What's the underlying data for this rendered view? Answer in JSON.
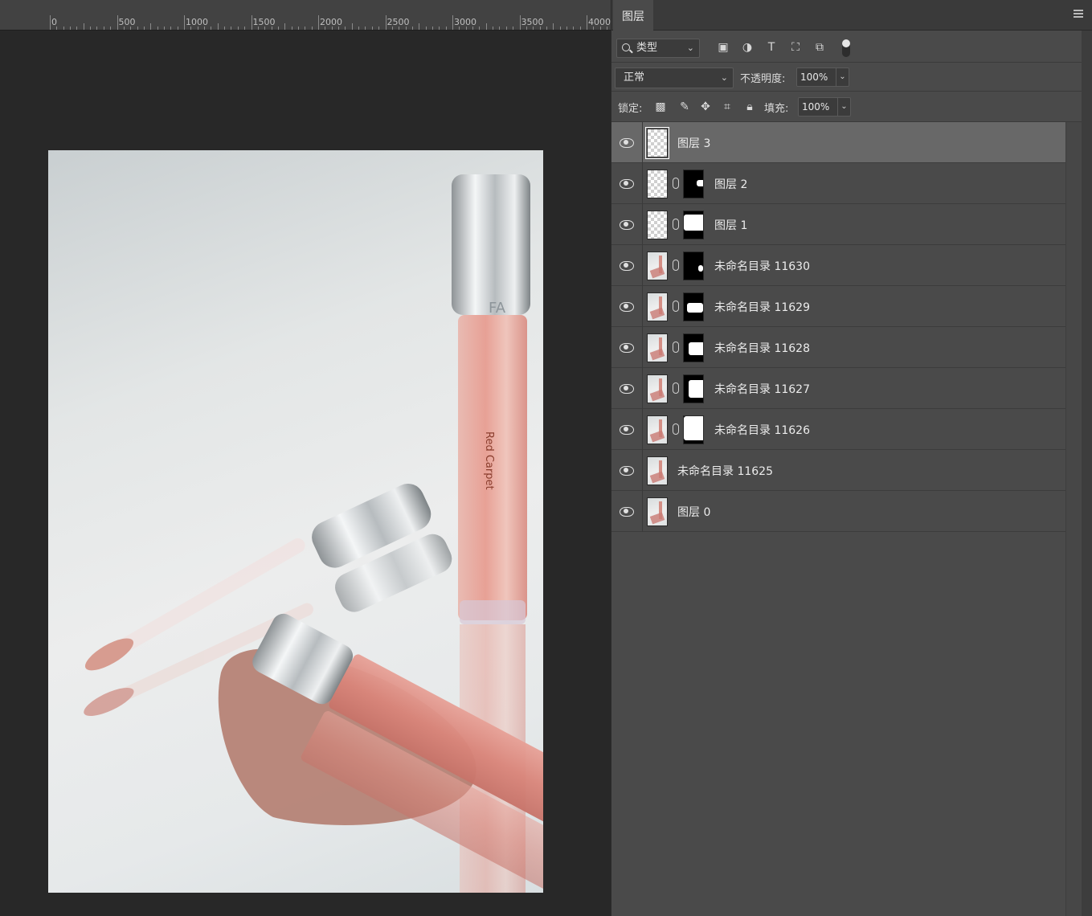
{
  "ruler": {
    "labels": [
      "0",
      "500",
      "1000",
      "1500",
      "2000",
      "2500",
      "3000",
      "3500",
      "4000"
    ]
  },
  "panel": {
    "tab_label": "图层",
    "filter": {
      "label": "类型"
    },
    "filter_icons": [
      "image-filter-icon",
      "adjustment-filter-icon",
      "type-filter-icon",
      "shape-filter-icon",
      "smart-object-filter-icon"
    ],
    "blend_mode": "正常",
    "opacity_label": "不透明度:",
    "opacity_value": "100%",
    "lock_label": "锁定:",
    "fill_label": "填充:",
    "fill_value": "100%"
  },
  "layers": [
    {
      "name": "图层 3",
      "selected": true,
      "thumb": "transparent",
      "mask": false
    },
    {
      "name": "图层 2",
      "selected": false,
      "thumb": "transparent",
      "mask": true
    },
    {
      "name": "图层 1",
      "selected": false,
      "thumb": "transparent",
      "mask": true
    },
    {
      "name": "未命名目录 11630",
      "selected": false,
      "thumb": "photo",
      "mask": true
    },
    {
      "name": "未命名目录 11629",
      "selected": false,
      "thumb": "photo",
      "mask": true
    },
    {
      "name": "未命名目录 11628",
      "selected": false,
      "thumb": "photo",
      "mask": true
    },
    {
      "name": "未命名目录 11627",
      "selected": false,
      "thumb": "photo",
      "mask": true
    },
    {
      "name": "未命名目录 11626",
      "selected": false,
      "thumb": "photo",
      "mask": true
    },
    {
      "name": "未命名目录 11625",
      "selected": false,
      "thumb": "photo",
      "mask": false
    },
    {
      "name": "图层 0",
      "selected": false,
      "thumb": "photo",
      "mask": false
    }
  ],
  "document": {
    "product_text_1": "FA",
    "product_text_2": "Red Carpet"
  }
}
